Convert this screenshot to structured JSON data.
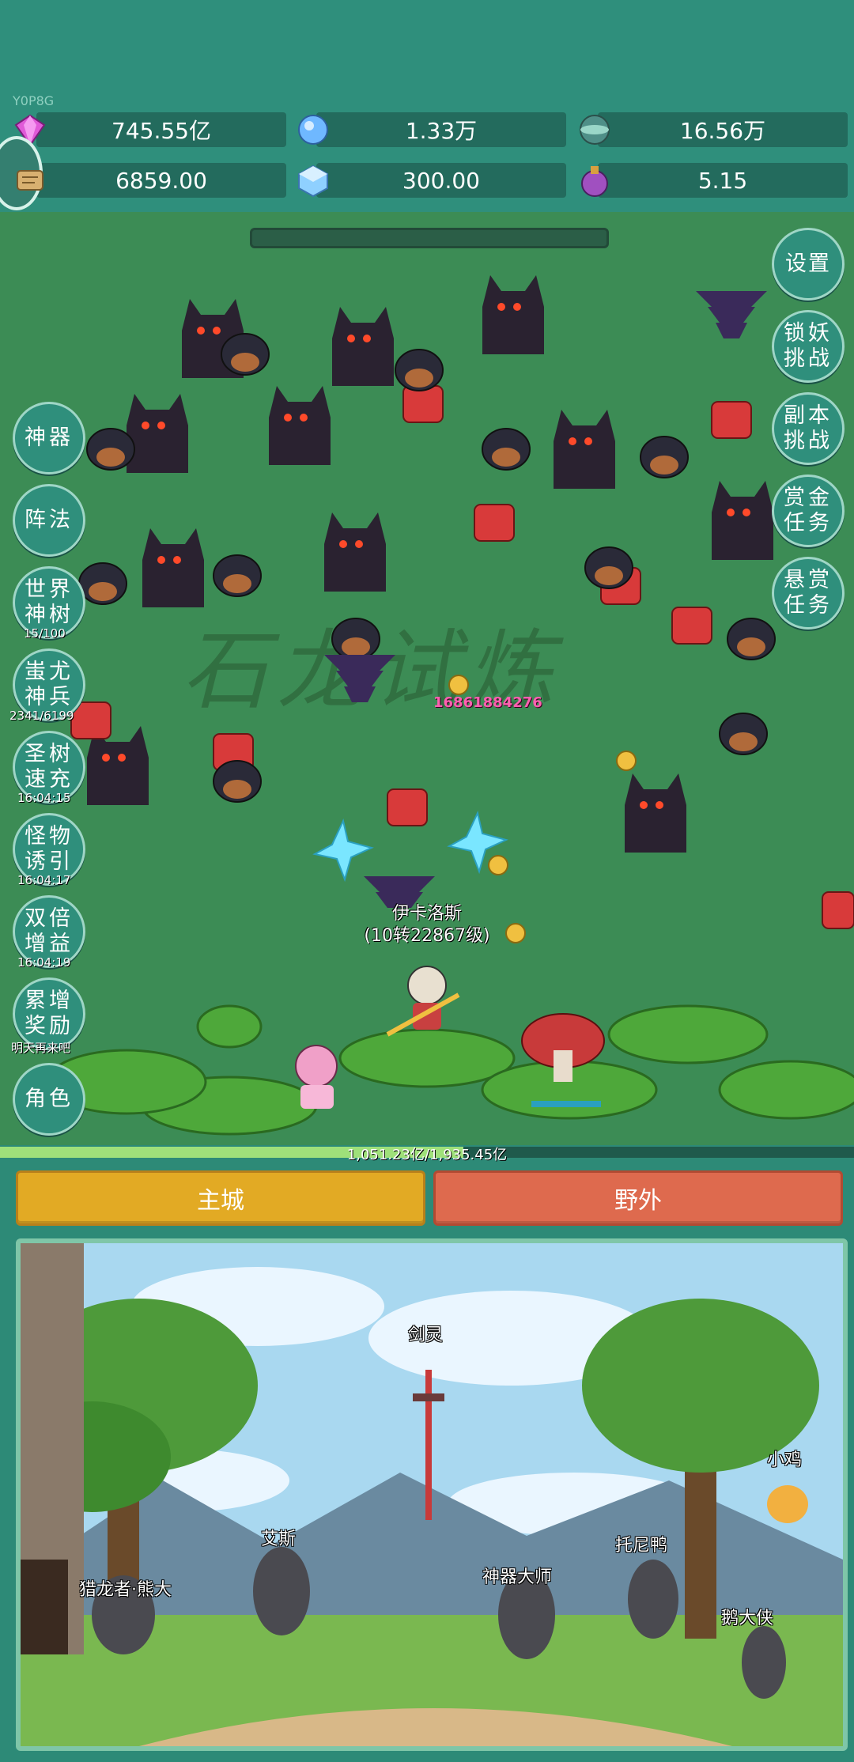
{
  "header": {
    "uid": "Y0P8G",
    "resources": [
      {
        "name": "gem-icon",
        "value": "745.55亿",
        "color": "#e05ad8"
      },
      {
        "name": "crystal-icon",
        "value": "1.33万",
        "color": "#6fb8ff"
      },
      {
        "name": "orb-icon",
        "value": "16.56万",
        "color": "#7ab0a0"
      },
      {
        "name": "scroll-icon",
        "value": "6859.00",
        "color": "#d8b070"
      },
      {
        "name": "ice-cube-icon",
        "value": "300.00",
        "color": "#8fd0ff"
      },
      {
        "name": "potion-icon",
        "value": "5.15",
        "color": "#a050c0"
      }
    ]
  },
  "left_menu": [
    {
      "label": "神器",
      "timer": ""
    },
    {
      "label": "阵法",
      "timer": ""
    },
    {
      "label": "世界神树",
      "timer": "15/100"
    },
    {
      "label": "蚩尤神兵",
      "timer": "2341/6199"
    },
    {
      "label": "圣树速充",
      "timer": "16:04:15"
    },
    {
      "label": "怪物诱引",
      "timer": "16:04:17"
    },
    {
      "label": "双倍增益",
      "timer": "16:04:19"
    },
    {
      "label": "累增奖励",
      "timer": "明天再来吧"
    },
    {
      "label": "角色",
      "timer": ""
    }
  ],
  "right_menu": [
    {
      "label": "设置"
    },
    {
      "label": "锁妖挑战"
    },
    {
      "label": "副本挑战"
    },
    {
      "label": "赏金任务"
    },
    {
      "label": "悬赏任务"
    }
  ],
  "battle": {
    "watermark": "石龙试炼",
    "damage": "16861884276",
    "player_name": "伊卡洛斯",
    "player_level": "(10转22867级)",
    "hp_text": "1,051.23亿/1,935.45亿",
    "hp_fraction": 0.543
  },
  "tabs": {
    "main_city": "主城",
    "wild": "野外"
  },
  "npcs": [
    {
      "label": "剑灵"
    },
    {
      "label": "小鸡"
    },
    {
      "label": "艾斯"
    },
    {
      "label": "托尼鸭"
    },
    {
      "label": "猎龙者·熊大"
    },
    {
      "label": "神器大师"
    },
    {
      "label": "鹅大侠"
    }
  ]
}
